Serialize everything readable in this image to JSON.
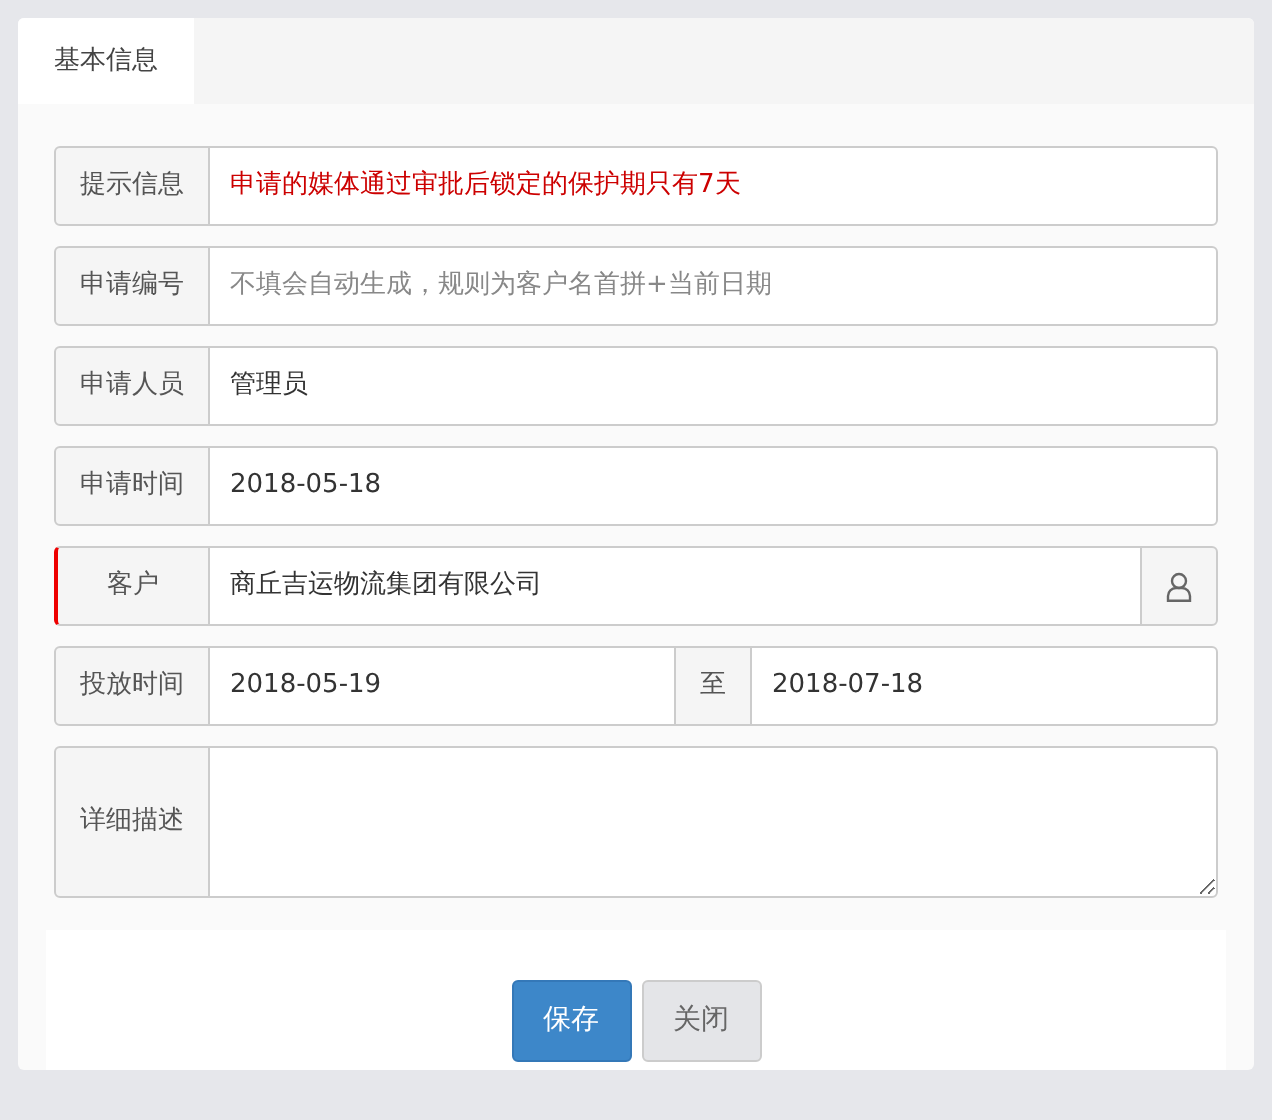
{
  "tabs": [
    {
      "label": "基本信息",
      "selected": true
    }
  ],
  "rows": [
    {
      "kind": "notice",
      "label": "提示信息",
      "text": "申请的媒体通过审批后锁定的保护期只有7天"
    },
    {
      "kind": "input",
      "label": "申请编号",
      "placeholder": "不填会自动生成，规则为客户名首拼+当前日期"
    },
    {
      "kind": "input",
      "label": "申请人员",
      "value": "管理员"
    },
    {
      "kind": "input",
      "label": "申请时间",
      "value": "2018-05-18"
    },
    {
      "kind": "picker",
      "label": "客户",
      "value": "商丘吉运物流集团有限公司",
      "required": true
    },
    {
      "kind": "range",
      "label": "投放时间",
      "from": "2018-05-19",
      "separator": "至",
      "to": "2018-07-18"
    },
    {
      "kind": "textarea",
      "label": "详细描述"
    }
  ],
  "buttons": [
    {
      "label": "保存",
      "kind": "primary"
    },
    {
      "label": "关闭",
      "kind": "secondary"
    }
  ]
}
